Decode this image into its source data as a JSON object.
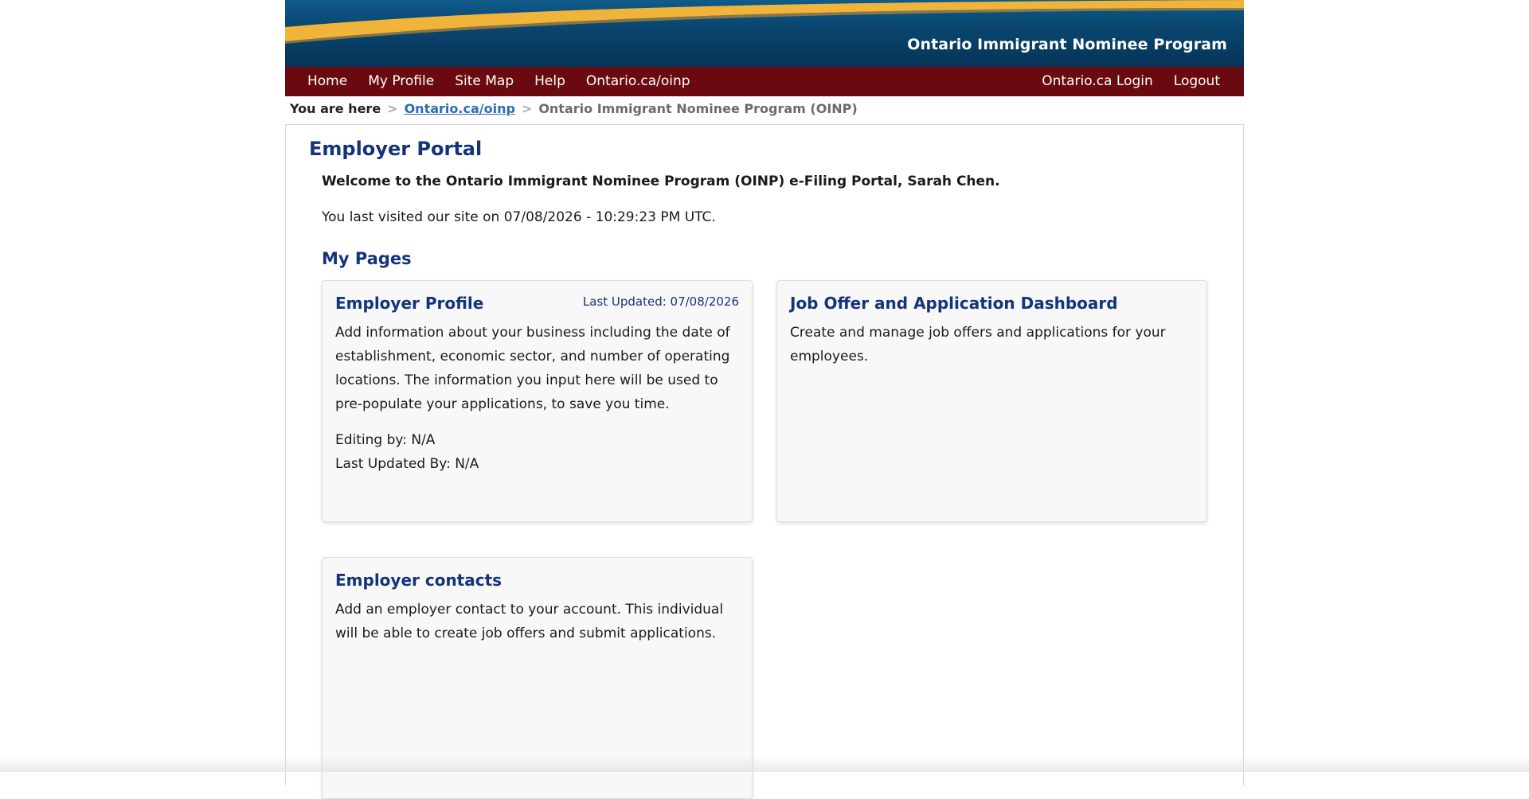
{
  "header": {
    "program_title": "Ontario Immigrant Nominee Program",
    "colors": {
      "banner_blue": "#0a4670",
      "gold_swoosh": "#f0b43a",
      "nav_red": "#6a0a10"
    }
  },
  "nav": {
    "left_items": [
      "Home",
      "My Profile",
      "Site Map",
      "Help",
      "Ontario.ca/oinp"
    ],
    "right_items": [
      "Ontario.ca Login",
      "Logout"
    ]
  },
  "breadcrumb": {
    "label": "You are here",
    "separator": ">",
    "link": "Ontario.ca/oinp",
    "current": "Ontario Immigrant Nominee Program (OINP)"
  },
  "main": {
    "title": "Employer Portal",
    "welcome": "Welcome to the Ontario Immigrant Nominee Program (OINP) e-Filing Portal, Sarah Chen.",
    "last_visit": "You last visited our site on 07/08/2026 - 10:29:23 PM UTC.",
    "my_pages_heading": "My Pages"
  },
  "cards": {
    "employer_profile": {
      "title": "Employer Profile",
      "updated": "Last Updated: 07/08/2026",
      "description": "Add information about your business including the date of establishment, economic sector, and number of operating locations. The information you input here will be used to pre-populate your applications, to save you time.",
      "editing_by": "Editing by: N/A",
      "last_updated_by": "Last Updated By: N/A"
    },
    "job_offer": {
      "title": "Job Offer and Application Dashboard",
      "description": "Create and manage job offers and applications for your employees."
    },
    "employer_contacts": {
      "title": "Employer contacts",
      "description": "Add an employer contact to your account. This individual will be able to create job offers and submit applications."
    }
  }
}
